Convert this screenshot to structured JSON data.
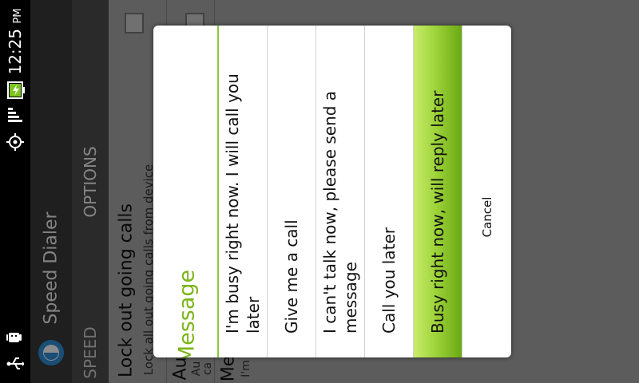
{
  "status": {
    "time": "12:25",
    "ampm": "PM",
    "icons": [
      "usb-icon",
      "android-icon",
      "gps-icon",
      "signal-icon",
      "battery-charging-icon"
    ]
  },
  "app": {
    "title": "Speed Dialer",
    "tabs": [
      "SPEED",
      "OPTIONS"
    ],
    "settings": [
      {
        "title": "Lock out going calls",
        "subtitle": "Lock all out going calls from device"
      },
      {
        "title": "Au",
        "subtitle": "Au"
      },
      {
        "title": "Me",
        "subtitle": "I'm"
      }
    ],
    "partial_text": "ca"
  },
  "dialog": {
    "title": "Message",
    "options": [
      "I'm busy right now. I will call you later",
      "Give me a call",
      "I can't talk now, please send a message",
      "Call you later",
      "Busy right now, will reply later"
    ],
    "selected_index": 4,
    "cancel_label": "Cancel"
  },
  "colors": {
    "accent": "#7cb518",
    "selected_gradient_start": "#c9ec6a",
    "selected_gradient_end": "#6aa814"
  }
}
